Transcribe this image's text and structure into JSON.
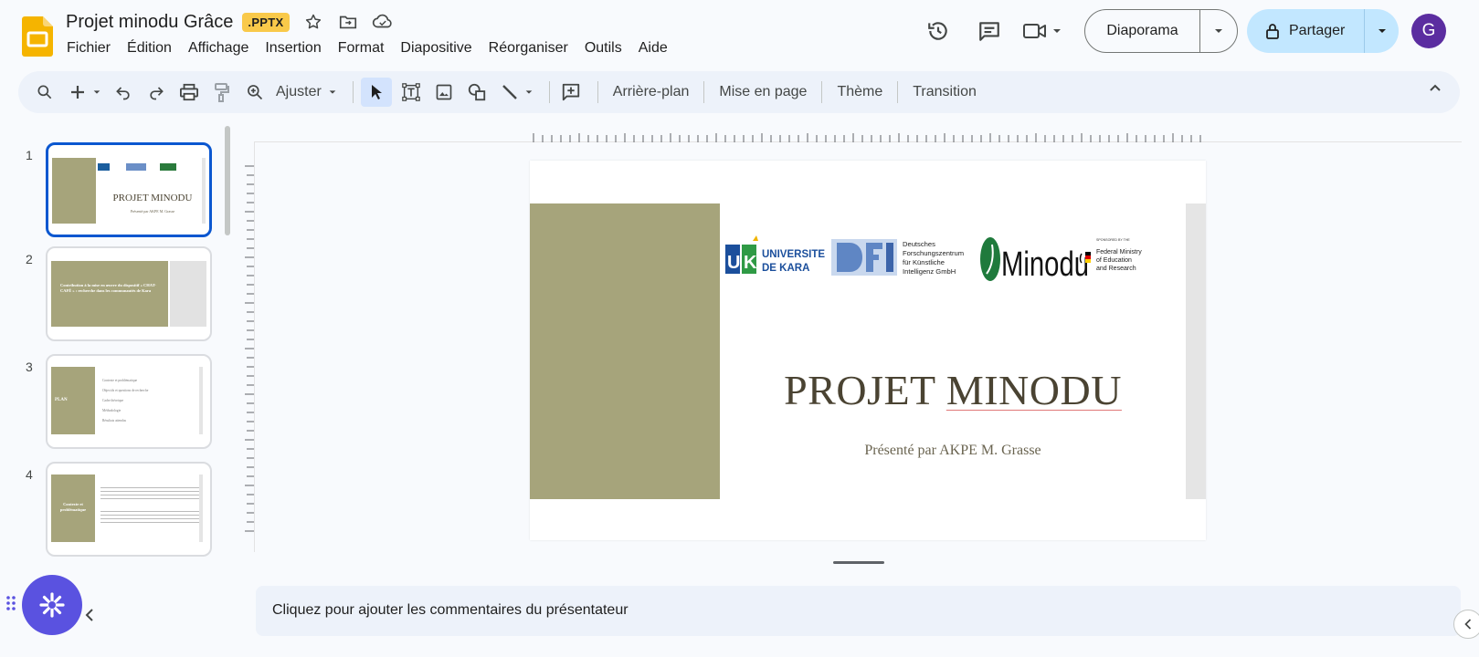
{
  "header": {
    "title": "Projet minodu Grâce",
    "badge": ".PPTX",
    "menu": [
      "Fichier",
      "Édition",
      "Affichage",
      "Insertion",
      "Format",
      "Diapositive",
      "Réorganiser",
      "Outils",
      "Aide"
    ],
    "slideshow_label": "Diaporama",
    "share_label": "Partager",
    "avatar_letter": "G"
  },
  "toolbar": {
    "zoom_label": "Ajuster",
    "background_label": "Arrière-plan",
    "layout_label": "Mise en page",
    "theme_label": "Thème",
    "transition_label": "Transition"
  },
  "filmstrip": {
    "slides": [
      {
        "number": "1",
        "title": "PROJET MINODU",
        "subtitle": "Présenté par AKPE M. Grasse"
      },
      {
        "number": "2",
        "text": "Contribution à la mise en œuvre du dispositif « CHAT-CAFÉ » : recherche dans les communautés de Kara"
      },
      {
        "number": "3",
        "label": "PLAN",
        "items": [
          "Contexte et problématique",
          "Objectifs et questions de recherche",
          "Cadre théorique",
          "Méthodologie",
          "Résultats attendus"
        ]
      },
      {
        "number": "4",
        "label": "Contexte et problématique"
      }
    ]
  },
  "slide": {
    "title_part1": "PROJET ",
    "title_part2": "MINODU",
    "subtitle": "Présenté par AKPE M. Grasse",
    "logos": {
      "uk_text1": "UNIVERSITE",
      "uk_text2": "DE KARA",
      "dfki_line1": "Deutsches",
      "dfki_line2": "Forschungszentrum",
      "dfki_line3": "für Künstliche",
      "dfki_line4": "Intelligenz GmbH",
      "minodu": "Minodu",
      "bmbf_top": "SPONSORED BY THE",
      "bmbf_line1": "Federal Ministry",
      "bmbf_line2": "of Education",
      "bmbf_line3": "and Research"
    }
  },
  "notes_placeholder": "Cliquez pour ajouter les commentaires du présentateur",
  "colors": {
    "accent_blue": "#0b57d0",
    "olive": "#a6a47b",
    "share_bg": "#c2e7ff",
    "badge": "#f9c94a",
    "avatar": "#5b2da0",
    "fab": "#5a52e0"
  }
}
